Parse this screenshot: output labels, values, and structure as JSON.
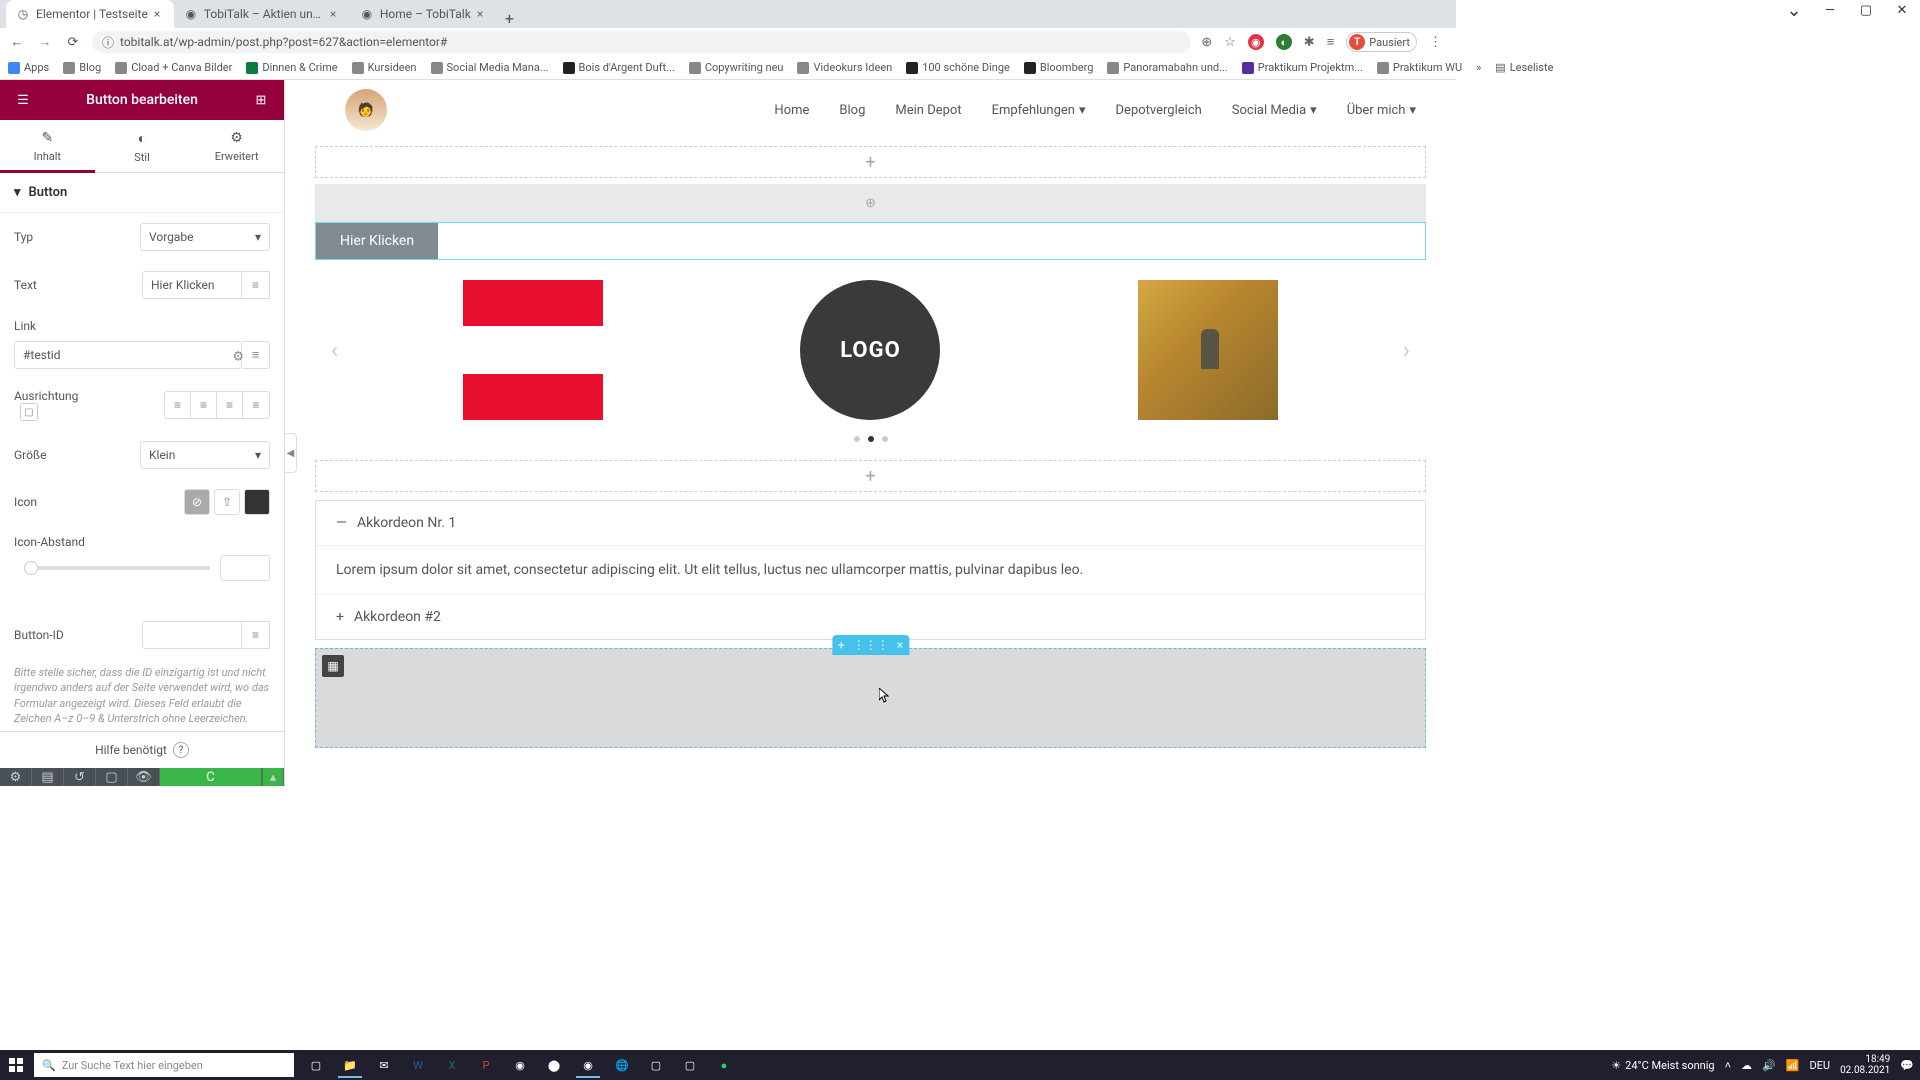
{
  "browser": {
    "tabs": [
      {
        "title": "Elementor | Testseite",
        "active": true
      },
      {
        "title": "TobiTalk – Aktien und persönlich",
        "active": false
      },
      {
        "title": "Home – TobiTalk",
        "active": false
      }
    ],
    "url": "tobitalk.at/wp-admin/post.php?post=627&action=elementor#",
    "pausiert": "Pausiert",
    "pausiert_initial": "T",
    "bookmarks": [
      "Apps",
      "Blog",
      "Cload + Canva Bilder",
      "Dinnen & Crime",
      "Kursideen",
      "Social Media Mana...",
      "Bois d'Argent Duft...",
      "Copywriting neu",
      "Videokurs Ideen",
      "100 schöne Dinge",
      "Bloomberg",
      "Panoramabahn und...",
      "Praktikum Projektm...",
      "Praktikum WU"
    ],
    "leseliste": "Leseliste"
  },
  "elementor": {
    "header_title": "Button bearbeiten",
    "tabs": {
      "inhalt": "Inhalt",
      "stil": "Stil",
      "erweitert": "Erweitert"
    },
    "section": "Button",
    "labels": {
      "typ": "Typ",
      "text": "Text",
      "link": "Link",
      "ausrichtung": "Ausrichtung",
      "groesse": "Größe",
      "icon": "Icon",
      "icon_abstand": "Icon-Abstand",
      "button_id": "Button-ID"
    },
    "values": {
      "typ": "Vorgabe",
      "text": "Hier Klicken",
      "link": "#testid",
      "groesse": "Klein",
      "button_id": ""
    },
    "id_help": "Bitte stelle sicher, dass die ID einzigartig ist und nicht irgendwo anders auf der Seite verwendet wird, wo das Formular angezeigt wird. Dieses Feld erlaubt die Zeichen A–z  0–9 & Unterstrich ohne Leerzeichen.",
    "help_needed": "Hilfe benötigt"
  },
  "site": {
    "nav": [
      "Home",
      "Blog",
      "Mein Depot",
      "Empfehlungen",
      "Depotvergleich",
      "Social Media",
      "Über mich"
    ],
    "nav_dropdown": [
      false,
      false,
      false,
      true,
      false,
      true,
      true
    ],
    "button_label": "Hier Klicken",
    "logo_text": "LOGO",
    "accordion": [
      {
        "title": "Akkordeon Nr. 1",
        "open": true,
        "body": "Lorem ipsum dolor sit amet, consectetur adipiscing elit. Ut elit tellus, luctus nec ullamcorper mattis, pulvinar dapibus leo."
      },
      {
        "title": "Akkordeon #2",
        "open": false
      }
    ]
  },
  "taskbar": {
    "search_placeholder": "Zur Suche Text hier eingeben",
    "weather": "24°C  Meist sonnig",
    "time": "18:49",
    "date": "02.08.2021",
    "lang": "DEU"
  },
  "chart_data": null
}
